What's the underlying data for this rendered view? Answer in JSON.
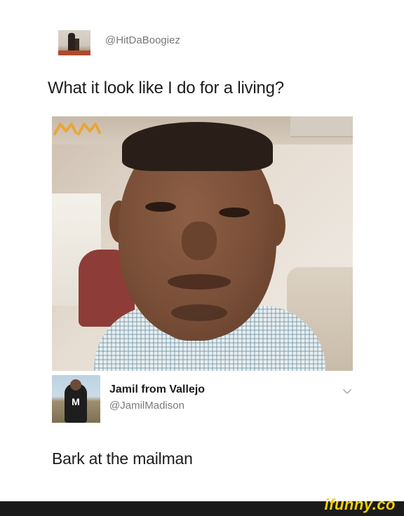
{
  "original_post": {
    "handle": "@HitDaBoogiez",
    "text": "What it look like I do for a living?"
  },
  "photo": {
    "sticker_text": "ᴹᴹ"
  },
  "reply": {
    "name": "Jamil from Vallejo",
    "handle": "@JamilMadison",
    "text": "Bark at the mailman",
    "avatar_mark": "M"
  },
  "icons": {
    "chevron": "chevron-down-icon"
  },
  "footer": {
    "watermark": "ifunny.co"
  },
  "colors": {
    "watermark": "#f3d200",
    "footer_bar": "#1a1a1a",
    "handle_gray": "#7a7a7a"
  }
}
